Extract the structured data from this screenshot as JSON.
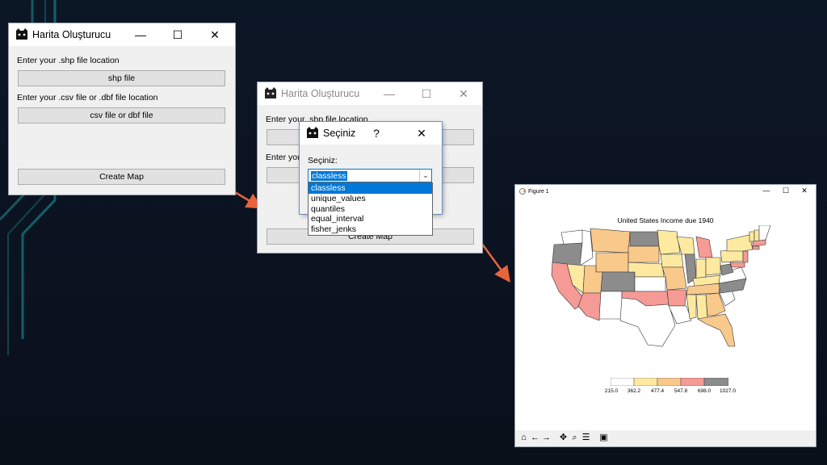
{
  "windows": {
    "main": {
      "title": "Harita Oluşturucu",
      "shp_label": "Enter your .shp file location",
      "shp_button": "shp file",
      "csv_label": "Enter your .csv file or .dbf file location",
      "csv_button": "csv file or dbf file",
      "create_button": "Create Map"
    },
    "second": {
      "title": "Harita Oluşturucu",
      "shp_label": "Enter your .shp file location",
      "csv_label_partial": "Enter you",
      "create_button": "Create Map"
    },
    "dialog": {
      "title": "Seçiniz",
      "help": "?",
      "prompt": "Seçiniz:",
      "selected": "classless",
      "options": [
        "classless",
        "unique_values",
        "quantiles",
        "equal_interval",
        "fisher_jenks"
      ]
    }
  },
  "figure": {
    "window_title": "Figure 1",
    "chart_data": {
      "type": "choropleth",
      "title": "United States Income due 1940",
      "legend_ticks": [
        "215.0",
        "362.2",
        "477.4",
        "547.8",
        "698.0",
        "1027.0"
      ],
      "legend_colors": [
        "#ffffff",
        "#fde9a0",
        "#f9c98b",
        "#f8c886",
        "#f59a95",
        "#8c8c8c"
      ]
    },
    "toolbar": [
      "home-icon",
      "back-icon",
      "forward-icon",
      "pan-icon",
      "zoom-icon",
      "configure-icon",
      "save-icon"
    ]
  },
  "controls": {
    "minimize": "—",
    "maximize": "☐",
    "close": "✕",
    "dropdown_arrow": "⌄"
  },
  "colors": {
    "background": "#0b1220",
    "accent": "#0078d7",
    "arrow": "#e8643c",
    "deco_line": "#1aa0a0"
  }
}
